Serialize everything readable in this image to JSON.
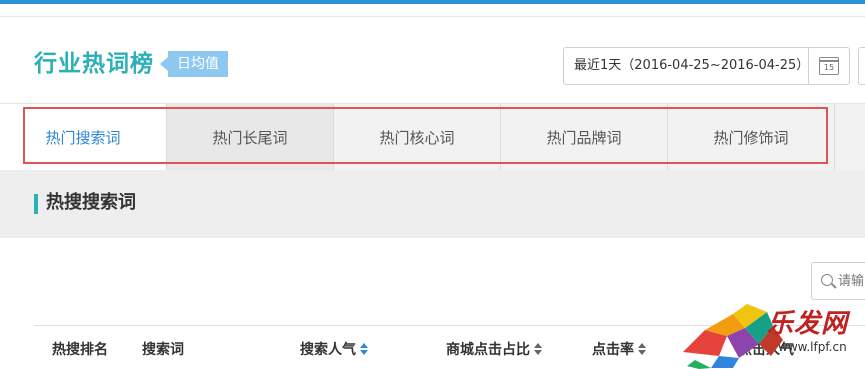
{
  "header": {
    "title": "行业热词榜",
    "badge": "日均值",
    "date_range": "最近1天（2016-04-25~2016-04-25）",
    "calendar_day": "15"
  },
  "tabs": [
    {
      "label": "热门搜索词",
      "active": true
    },
    {
      "label": "热门长尾词",
      "active": false
    },
    {
      "label": "热门核心词",
      "active": false
    },
    {
      "label": "热门品牌词",
      "active": false
    },
    {
      "label": "热门修饰词",
      "active": false
    }
  ],
  "section": {
    "title": "热搜搜索词"
  },
  "search": {
    "placeholder": "请输"
  },
  "table": {
    "columns": [
      "热搜排名",
      "搜索词",
      "搜索人气",
      "商城点击占比",
      "点击率",
      "点击人气"
    ]
  },
  "watermark": {
    "brand": "乐发网",
    "url": "www.lfpf.cn"
  },
  "colors": {
    "accent_teal": "#2bb0b8",
    "active_tab_blue": "#2e86d6",
    "highlight_red": "#e05454",
    "badge_blue": "#8ec8f0"
  }
}
